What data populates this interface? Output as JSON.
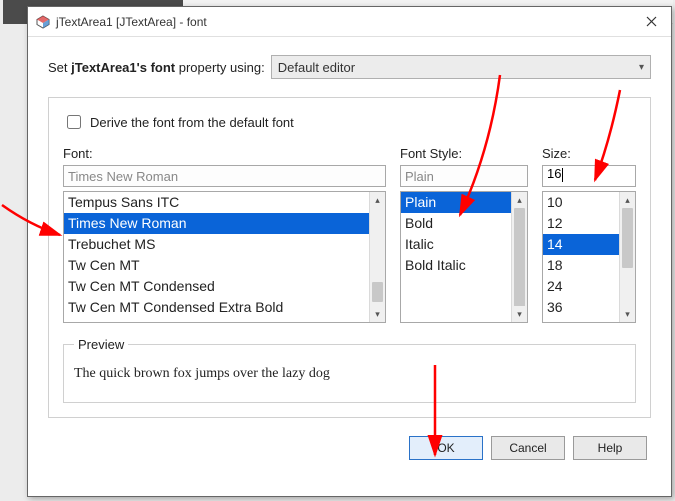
{
  "window": {
    "title": "jTextArea1 [JTextArea] - font"
  },
  "editor_row": {
    "prefix": "Set ",
    "component": "jTextArea1",
    "suffix_bold": "'s font",
    "suffix": " property using:",
    "combo_value": "Default editor"
  },
  "derive_label": "Derive the font from the default font",
  "columns": {
    "font": {
      "label": "Font:",
      "value": "Times New Roman",
      "items": [
        "Tempus Sans ITC",
        "Times New Roman",
        "Trebuchet MS",
        "Tw Cen MT",
        "Tw Cen MT Condensed",
        "Tw Cen MT Condensed Extra Bold"
      ],
      "selected_index": 1
    },
    "style": {
      "label": "Font Style:",
      "value": "Plain",
      "items": [
        "Plain",
        "Bold",
        "Italic",
        "Bold Italic"
      ],
      "selected_index": 0
    },
    "size": {
      "label": "Size:",
      "value": "16",
      "items": [
        "10",
        "12",
        "14",
        "18",
        "24",
        "36"
      ],
      "selected_index": 2
    }
  },
  "preview": {
    "legend": "Preview",
    "text": "The quick brown fox jumps over the lazy dog"
  },
  "buttons": {
    "ok": "OK",
    "cancel": "Cancel",
    "help": "Help"
  }
}
